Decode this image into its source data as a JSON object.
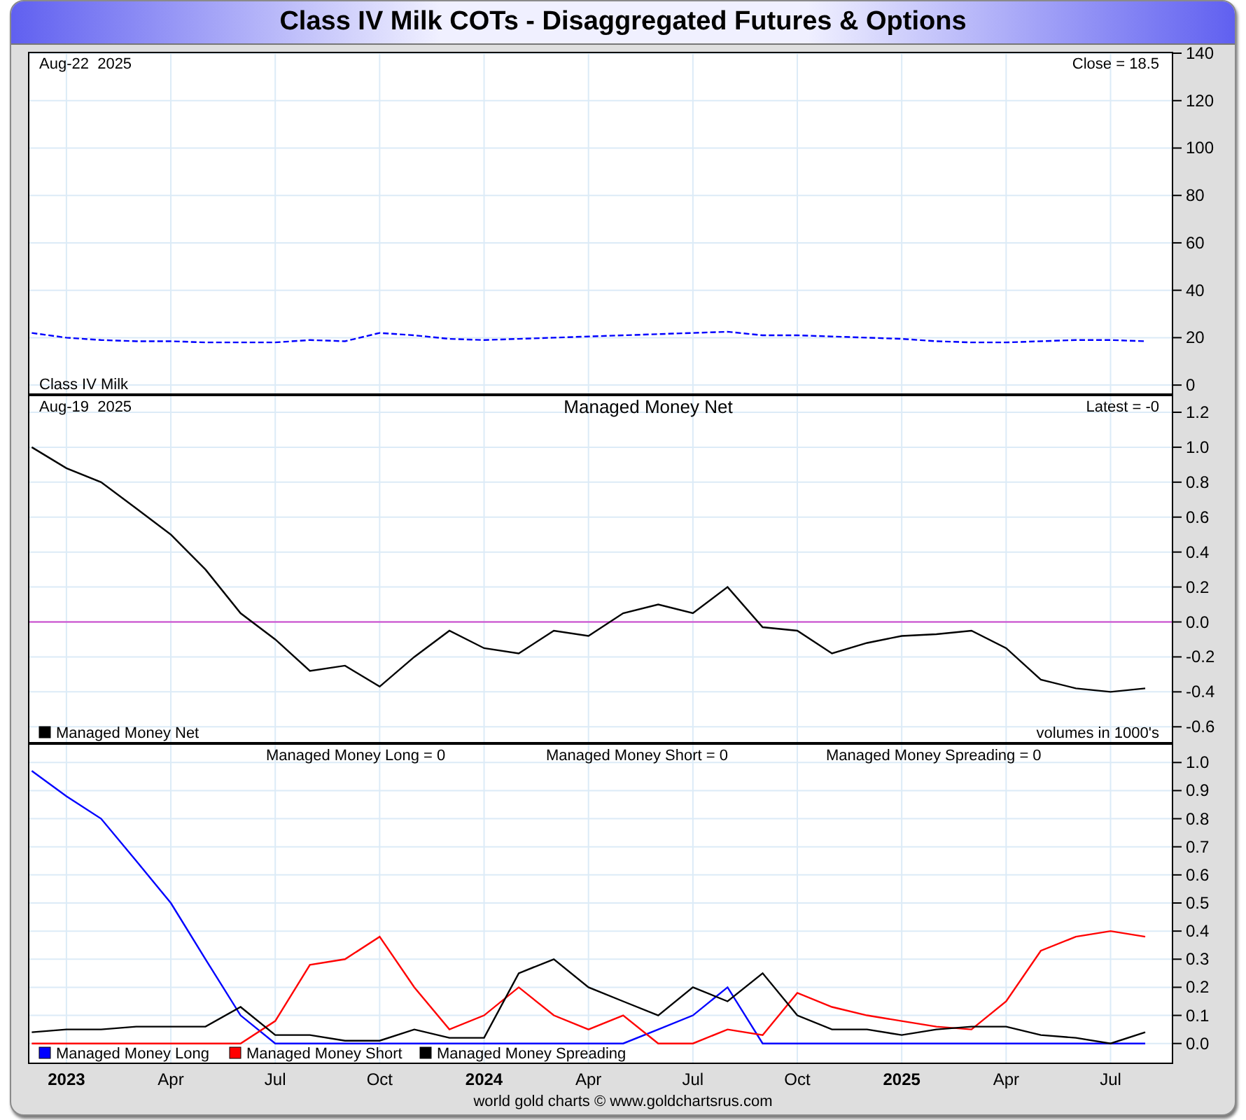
{
  "title": "Class IV Milk COTs - Disaggregated Futures & Options",
  "panels": [
    {
      "top_left": "Aug-22  2025",
      "top_right": "Close = 18.5",
      "chart_data": {
        "type": "line",
        "grid": true,
        "x": [
          2022.917,
          2023,
          2023.083,
          2023.167,
          2023.25,
          2023.333,
          2023.417,
          2023.5,
          2023.583,
          2023.667,
          2023.75,
          2023.833,
          2023.917,
          2024,
          2024.083,
          2024.167,
          2024.25,
          2024.333,
          2024.417,
          2024.5,
          2024.583,
          2024.667,
          2024.75,
          2024.833,
          2024.917,
          2025,
          2025.083,
          2025.167,
          2025.25,
          2025.333,
          2025.417,
          2025.5,
          2025.583
        ],
        "xlim": [
          2022.908,
          2025.65
        ],
        "ylim": [
          -4.1,
          140.6
        ],
        "yticks": [
          0,
          20,
          40,
          60,
          80,
          100,
          120,
          140
        ],
        "series": [
          {
            "name": "Class IV Milk",
            "color": "#0000ff",
            "line_style": "dashed",
            "values": [
              22,
              20,
              19,
              18.5,
              18.5,
              18,
              18,
              18,
              19,
              18.5,
              22,
              21,
              19.5,
              19,
              19.5,
              20,
              20.5,
              21,
              21.5,
              22,
              22.5,
              21,
              21,
              20.5,
              20,
              19.5,
              18.5,
              18,
              18,
              18.5,
              19,
              19,
              18.5
            ]
          }
        ]
      }
    },
    {
      "top_left": "Aug-19  2025",
      "top_right": "Latest = -0",
      "bottom_right": "volumes in 1000's",
      "chart_data": {
        "type": "line",
        "grid": true,
        "legend": true,
        "ref_lines": [
          {
            "axis": "y",
            "value": 0,
            "color": "#cc44cc"
          }
        ],
        "title": "Managed Money Net",
        "x": [
          2022.917,
          2023,
          2023.083,
          2023.167,
          2023.25,
          2023.333,
          2023.417,
          2023.5,
          2023.583,
          2023.667,
          2023.75,
          2023.833,
          2023.917,
          2024,
          2024.083,
          2024.167,
          2024.25,
          2024.333,
          2024.417,
          2024.5,
          2024.583,
          2024.667,
          2024.75,
          2024.833,
          2024.917,
          2025,
          2025.083,
          2025.167,
          2025.25,
          2025.333,
          2025.417,
          2025.5,
          2025.583
        ],
        "xlim": [
          2022.908,
          2025.65
        ],
        "ylim": [
          -0.695,
          1.3
        ],
        "yticks": [
          {
            "value": -0.6,
            "label": "-0.6"
          },
          {
            "value": -0.4,
            "label": "-0.4"
          },
          {
            "value": -0.2,
            "label": "-0.2"
          },
          {
            "value": 0,
            "label": "0.0"
          },
          {
            "value": 0.2,
            "label": "0.2"
          },
          {
            "value": 0.4,
            "label": "0.4"
          },
          {
            "value": 0.6,
            "label": "0.6"
          },
          {
            "value": 0.8,
            "label": "0.8"
          },
          {
            "value": 1,
            "label": "1.0"
          },
          {
            "value": 1.2,
            "label": "1.2"
          }
        ],
        "series": [
          {
            "name": "Managed Money Net",
            "color": "#000000",
            "values": [
              1.0,
              0.88,
              0.8,
              0.65,
              0.5,
              0.3,
              0.05,
              -0.1,
              -0.28,
              -0.25,
              -0.37,
              -0.2,
              -0.05,
              -0.15,
              -0.18,
              -0.05,
              -0.08,
              0.05,
              0.1,
              0.05,
              0.2,
              -0.03,
              -0.05,
              -0.18,
              -0.12,
              -0.08,
              -0.07,
              -0.05,
              -0.15,
              -0.33,
              -0.38,
              -0.4,
              -0.38
            ]
          }
        ]
      }
    },
    {
      "readouts": [
        "Managed Money Long = 0",
        "Managed Money Short = 0",
        "Managed Money Spreading = 0"
      ],
      "chart_data": {
        "type": "line",
        "grid": true,
        "legend": true,
        "x": [
          2022.917,
          2023,
          2023.083,
          2023.167,
          2023.25,
          2023.333,
          2023.417,
          2023.5,
          2023.583,
          2023.667,
          2023.75,
          2023.833,
          2023.917,
          2024,
          2024.083,
          2024.167,
          2024.25,
          2024.333,
          2024.417,
          2024.5,
          2024.583,
          2024.667,
          2024.75,
          2024.833,
          2024.917,
          2025,
          2025.083,
          2025.167,
          2025.25,
          2025.333,
          2025.417,
          2025.5,
          2025.583
        ],
        "xlim": [
          2022.908,
          2025.65
        ],
        "ylim": [
          -0.073,
          1.068
        ],
        "xticks": [
          {
            "value": 2023,
            "label": "2023"
          },
          {
            "value": 2023.25,
            "label": "Apr"
          },
          {
            "value": 2023.5,
            "label": "Jul"
          },
          {
            "value": 2023.75,
            "label": "Oct"
          },
          {
            "value": 2024,
            "label": "2024"
          },
          {
            "value": 2024.25,
            "label": "Apr"
          },
          {
            "value": 2024.5,
            "label": "Jul"
          },
          {
            "value": 2024.75,
            "label": "Oct"
          },
          {
            "value": 2025,
            "label": "2025"
          },
          {
            "value": 2025.25,
            "label": "Apr"
          },
          {
            "value": 2025.5,
            "label": "Jul"
          }
        ],
        "yticks": [
          {
            "value": 0,
            "label": "0.0"
          },
          {
            "value": 0.1,
            "label": "0.1"
          },
          {
            "value": 0.2,
            "label": "0.2"
          },
          {
            "value": 0.3,
            "label": "0.3"
          },
          {
            "value": 0.4,
            "label": "0.4"
          },
          {
            "value": 0.5,
            "label": "0.5"
          },
          {
            "value": 0.6,
            "label": "0.6"
          },
          {
            "value": 0.7,
            "label": "0.7"
          },
          {
            "value": 0.8,
            "label": "0.8"
          },
          {
            "value": 0.9,
            "label": "0.9"
          },
          {
            "value": 1,
            "label": "1.0"
          }
        ],
        "series": [
          {
            "name": "Managed Money Long",
            "color": "#0000ff",
            "values": [
              0.97,
              0.88,
              0.8,
              0.65,
              0.5,
              0.3,
              0.1,
              0,
              0,
              0,
              0,
              0,
              0,
              0,
              0,
              0,
              0,
              0,
              0.05,
              0.1,
              0.2,
              0,
              0,
              0,
              0,
              0,
              0,
              0,
              0,
              0,
              0,
              0,
              0
            ]
          },
          {
            "name": "Managed Money Short",
            "color": "#ff0000",
            "values": [
              0,
              0,
              0,
              0,
              0,
              0,
              0,
              0.08,
              0.28,
              0.3,
              0.38,
              0.2,
              0.05,
              0.1,
              0.2,
              0.1,
              0.05,
              0.1,
              0,
              0,
              0.05,
              0.03,
              0.18,
              0.13,
              0.1,
              0.08,
              0.06,
              0.05,
              0.15,
              0.33,
              0.38,
              0.4,
              0.38
            ]
          },
          {
            "name": "Managed Money Spreading",
            "color": "#000000",
            "values": [
              0.04,
              0.05,
              0.05,
              0.06,
              0.06,
              0.06,
              0.13,
              0.03,
              0.03,
              0.01,
              0.01,
              0.05,
              0.02,
              0.02,
              0.25,
              0.3,
              0.2,
              0.15,
              0.1,
              0.2,
              0.15,
              0.25,
              0.1,
              0.05,
              0.05,
              0.03,
              0.05,
              0.06,
              0.06,
              0.03,
              0.02,
              0,
              0.04
            ]
          }
        ]
      }
    }
  ],
  "footer": "world gold charts © www.goldchartsrus.com"
}
